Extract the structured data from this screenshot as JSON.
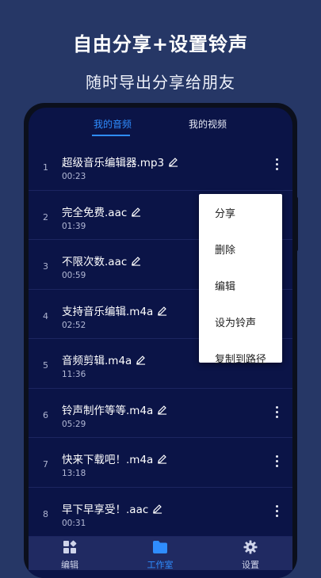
{
  "promo": {
    "headline": "自由分享+设置铃声",
    "subline": "随时导出分享给朋友"
  },
  "tabs": [
    {
      "label": "我的音频",
      "active": true
    },
    {
      "label": "我的视频",
      "active": false
    }
  ],
  "files": [
    {
      "index": "1",
      "name": "超级音乐编辑器.mp3",
      "duration": "00:23"
    },
    {
      "index": "2",
      "name": "完全免费.aac",
      "duration": "01:39"
    },
    {
      "index": "3",
      "name": "不限次数.aac",
      "duration": "00:59"
    },
    {
      "index": "4",
      "name": "支持音乐编辑.m4a",
      "duration": "02:52"
    },
    {
      "index": "5",
      "name": "音频剪辑.m4a",
      "duration": "11:36"
    },
    {
      "index": "6",
      "name": "铃声制作等等.m4a",
      "duration": "05:29"
    },
    {
      "index": "7",
      "name": "快来下载吧！.m4a",
      "duration": "13:18"
    },
    {
      "index": "8",
      "name": "早下早享受！.aac",
      "duration": "00:31"
    }
  ],
  "context_menu": {
    "items": [
      "分享",
      "删除",
      "编辑",
      "设为铃声",
      "复制到路径"
    ]
  },
  "bottom_nav": [
    {
      "label": "编辑",
      "icon": "grid-icon",
      "active": false
    },
    {
      "label": "工作室",
      "icon": "folder-icon",
      "active": true
    },
    {
      "label": "设置",
      "icon": "gear-icon",
      "active": false
    }
  ],
  "colors": {
    "background": "#263766",
    "screen": "#0b1447",
    "accent": "#2f8dff",
    "nav_bar": "#202a62"
  }
}
